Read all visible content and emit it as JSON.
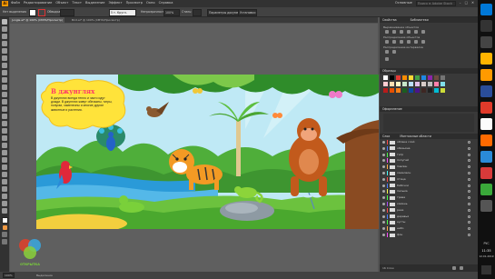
{
  "menubar": {
    "logo": "Ai",
    "items": [
      "Файл",
      "Редактирование",
      "Объект",
      "Текст",
      "Выделение",
      "Эффект",
      "Просмотр",
      "Окно",
      "Справка"
    ],
    "workspace": "Основные",
    "search_placeholder": "Поиск в Adobe Stock"
  },
  "control_bar": {
    "no_selection": "Нет выделения",
    "stroke_label": "Обводка:",
    "basic": "5 т. Кругл.",
    "opacity_label": "Непрозрачность:",
    "opacity_value": "100%",
    "style_label": "Стиль:",
    "document_setup": "Параметры документа",
    "preferences": "Установки"
  },
  "document_tabs": [
    {
      "label": "Jungle.ai* @ 100% (CMYK/Просмотр)",
      "active": true
    },
    {
      "label": "Bird.ai* @ 100% (CMYK/Просмотр)",
      "active": false
    }
  ],
  "artwork": {
    "title": "В джунглях",
    "text": "В джунглях всегда тепло и часто идут дожди. В джунглях живут обезьяны, тигры, попугаи, хамелеоны и многие другие животные и растения."
  },
  "right_panel": {
    "properties_tab": "Свойства",
    "libraries_tab": "Библиотеки",
    "section_align": "Выравнивание объектов",
    "section_distribute": "Распределение объектов",
    "section_spacing": "Распределение интервалов",
    "swatches_tab": "Образцы",
    "appearance_tab": "Оформление",
    "layers_tab": "Слои",
    "artboards_tab": "Монтажные области",
    "layers": [
      {
        "name": "облака слой",
        "color": "#ff4a4a"
      },
      {
        "name": "обезьяна",
        "color": "#4a7aff"
      },
      {
        "name": "тигр",
        "color": "#4aff4a"
      },
      {
        "name": "попугай",
        "color": "#ff4aff"
      },
      {
        "name": "павлин",
        "color": "#ffaa4a"
      },
      {
        "name": "хамелеон",
        "color": "#4affff"
      },
      {
        "name": "птица",
        "color": "#ff4a4a"
      },
      {
        "name": "бабочки",
        "color": "#4a7aff"
      },
      {
        "name": "пальма",
        "color": "#ffff4a"
      },
      {
        "name": "трава",
        "color": "#4aff4a"
      },
      {
        "name": "камень",
        "color": "#aa4aff"
      },
      {
        "name": "река",
        "color": "#ff4a4a"
      },
      {
        "name": "деревья",
        "color": "#4a7aff"
      },
      {
        "name": "кусты",
        "color": "#4aff4a"
      },
      {
        "name": "небо",
        "color": "#ffaa4a"
      },
      {
        "name": "фон",
        "color": "#ff4aff"
      }
    ],
    "layers_count": "16 Слои"
  },
  "status": {
    "zoom": "100%",
    "tool": "Выделение"
  },
  "taskbar": {
    "time": "11:35",
    "date": "12.01.2019",
    "lang": "РУС"
  },
  "watermark": "ОТКРЫТКА"
}
